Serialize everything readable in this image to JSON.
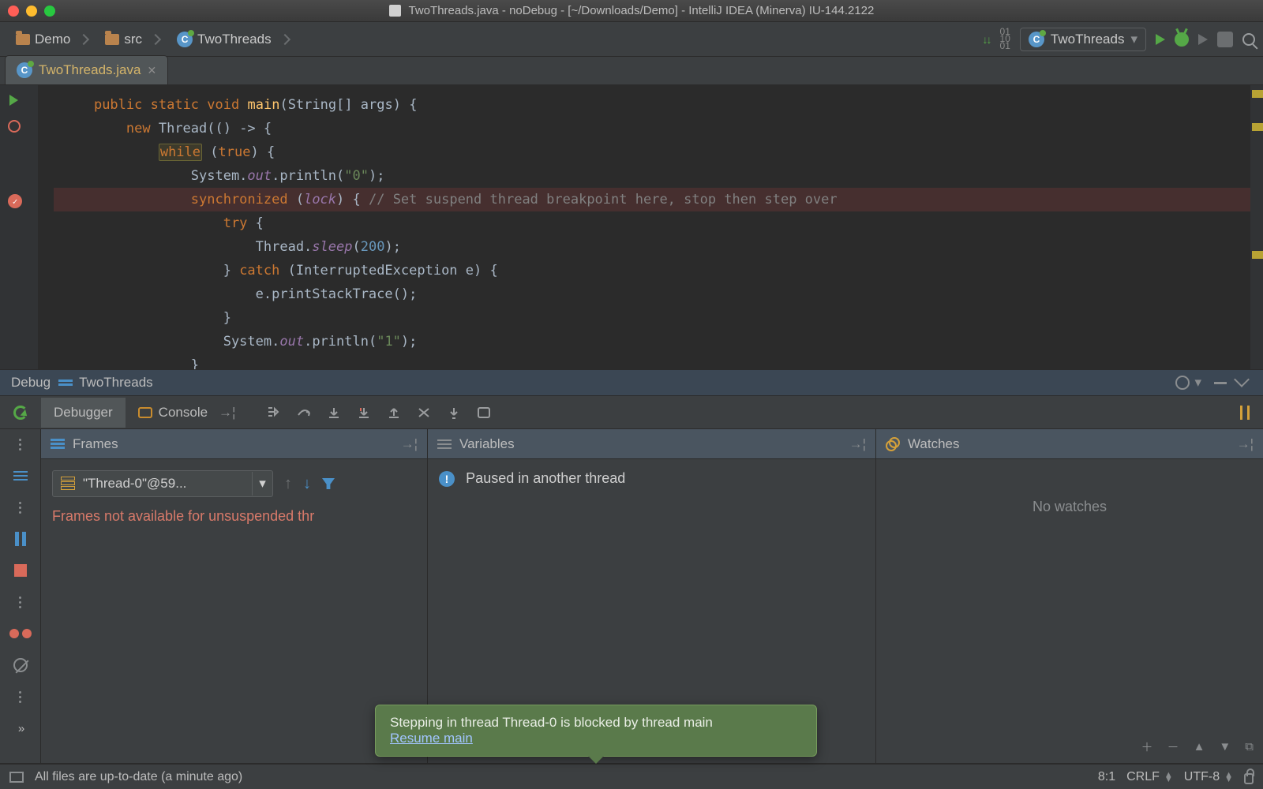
{
  "titlebar": {
    "title": "TwoThreads.java - noDebug - [~/Downloads/Demo] - IntelliJ IDEA (Minerva) IU-144.2122"
  },
  "breadcrumbs": {
    "items": [
      "Demo",
      "src",
      "TwoThreads"
    ]
  },
  "run": {
    "config": "TwoThreads"
  },
  "editor": {
    "tab": "TwoThreads.java",
    "code": {
      "l1a": "public",
      "l1b": "static",
      "l1c": "void",
      "l1d": "main",
      "l1e": "(String[] args) {",
      "l2a": "new",
      "l2b": " Thread(() -> {",
      "l3a": "while",
      "l3b": "(",
      "l3c": "true",
      "l3d": ") {",
      "l4a": "System.",
      "l4b": "out",
      "l4c": ".println(",
      "l4d": "\"0\"",
      "l4e": ");",
      "l5a": "synchronized",
      "l5b": " (",
      "l5c": "lock",
      "l5d": ") { ",
      "l5e": "// Set suspend thread breakpoint here, stop then step over",
      "l6a": "try",
      "l6b": " {",
      "l7a": "Thread.",
      "l7b": "sleep",
      "l7c": "(",
      "l7d": "200",
      "l7e": ");",
      "l8a": "} ",
      "l8b": "catch",
      "l8c": " (InterruptedException e) {",
      "l9a": "e.printStackTrace();",
      "l10a": "}",
      "l11a": "System.",
      "l11b": "out",
      "l11c": ".println(",
      "l11d": "\"1\"",
      "l11e": ");",
      "l12a": "}"
    }
  },
  "debug": {
    "title_label": "Debug",
    "title_config": "TwoThreads",
    "tabs": {
      "debugger": "Debugger",
      "console": "Console"
    },
    "frames": {
      "label": "Frames",
      "thread": "\"Thread-0\"@59...",
      "error": "Frames not available for unsuspended thr"
    },
    "variables": {
      "label": "Variables",
      "msg": "Paused in another thread"
    },
    "watches": {
      "label": "Watches",
      "empty": "No watches"
    },
    "tooltip": {
      "msg": "Stepping in thread Thread-0 is blocked by thread main",
      "link": "Resume main"
    }
  },
  "status": {
    "msg": "All files are up-to-date (a minute ago)",
    "pos": "8:1",
    "sep": "CRLF",
    "enc": "UTF-8"
  }
}
